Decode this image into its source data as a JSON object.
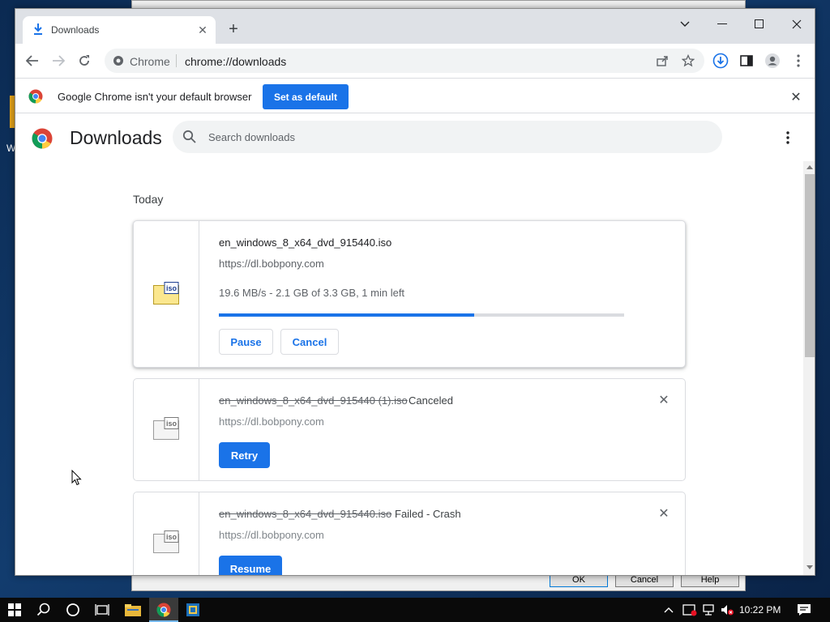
{
  "desktop": {
    "partial_icon_label": "W"
  },
  "background_dialog": {
    "buttons": {
      "ok": "OK",
      "cancel": "Cancel",
      "help": "Help"
    }
  },
  "browser": {
    "tab": {
      "title": "Downloads"
    },
    "omnibox": {
      "scheme_label": "Chrome",
      "url": "chrome://downloads"
    },
    "infobar": {
      "message": "Google Chrome isn't your default browser",
      "button": "Set as default"
    }
  },
  "downloads_page": {
    "title": "Downloads",
    "search_placeholder": "Search downloads",
    "date_header": "Today",
    "items": [
      {
        "filename": "en_windows_8_x64_dvd_915440.iso",
        "url": "https://dl.bobpony.com",
        "progress_text": "19.6 MB/s - 2.1 GB of 3.3 GB, 1 min left",
        "progress": 0.63,
        "buttons": [
          "Pause",
          "Cancel"
        ]
      },
      {
        "filename": "en_windows_8_x64_dvd_915440 (1).iso",
        "status": "Canceled",
        "url": "https://dl.bobpony.com",
        "button": "Retry"
      },
      {
        "filename": "en_windows_8_x64_dvd_915440.iso",
        "status": "Failed - Crash",
        "url": "https://dl.bobpony.com",
        "button": "Resume"
      }
    ],
    "file_icon_label": "iso"
  },
  "taskbar": {
    "clock": "10:22 PM"
  },
  "colors": {
    "accent": "#1a73e8",
    "tabstrip": "#dee1e6",
    "taskbar": "#0a0a0a"
  },
  "icons": [
    "windows-start-icon",
    "search-icon",
    "cortana-icon",
    "task-view-icon",
    "file-explorer-icon",
    "chrome-icon",
    "app-icon",
    "chevron-up-icon",
    "defender-icon",
    "network-icon",
    "volume-mute-icon",
    "notification-icon"
  ]
}
